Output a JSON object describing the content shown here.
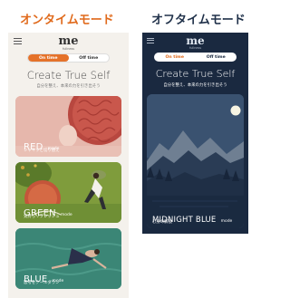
{
  "headings": {
    "on": "オンタイムモード",
    "off": "オフタイムモード"
  },
  "phone_on": {
    "logo": "me",
    "logo_sub": "fullness",
    "toggle": {
      "on_label": "On time",
      "off_label": "Off time",
      "selected": "On time"
    },
    "title": "Create True Self",
    "subtitle": "自分を整え、本来の力を引き出そう",
    "cards": [
      {
        "name": "RED",
        "suffix": "mode",
        "sub": "シャキッと切り替え"
      },
      {
        "name": "GREEN",
        "suffix": "mode",
        "sub": "気持ちリフレッシュ"
      },
      {
        "name": "BLUE",
        "suffix": "mode",
        "sub": "思考をクールダウン"
      }
    ]
  },
  "phone_off": {
    "logo": "me",
    "logo_sub": "fullness",
    "toggle": {
      "on_label": "On time",
      "off_label": "Off time",
      "selected": "Off time"
    },
    "title": "Create True Self",
    "subtitle": "自分を整え、本来の力を引き出そう",
    "card": {
      "name": "MIDNIGHT BLUE",
      "suffix": "mode",
      "sub": "心身の解放"
    }
  },
  "colors": {
    "on_accent": "#e5722a",
    "off_heading": "#1f3049",
    "dark_bg": "#1a2940"
  }
}
